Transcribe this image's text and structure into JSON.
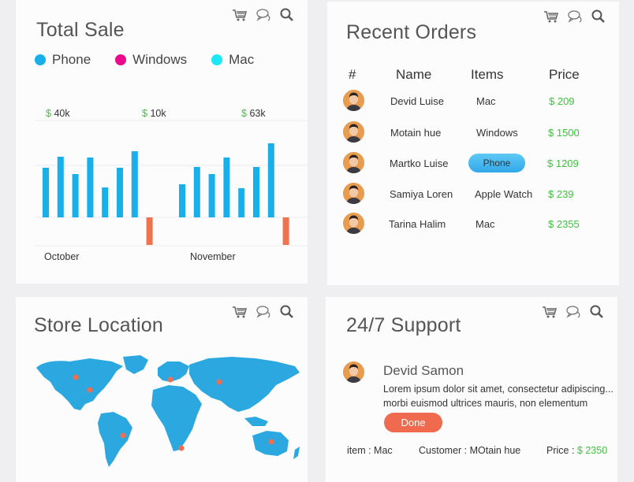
{
  "colors": {
    "phone": "#17b0ea",
    "windows": "#ec0a8c",
    "mac": "#1be8f5",
    "negative": "#f0734f",
    "price": "#3ec43e",
    "map": "#2ba8df",
    "marker": "#ee6f50"
  },
  "icons": [
    "cart-icon",
    "chat-icon",
    "search-icon"
  ],
  "total_sale": {
    "title": "Total Sale",
    "legend": [
      "Phone",
      "Windows",
      "Mac"
    ]
  },
  "chart_data": {
    "type": "bar",
    "series": [
      {
        "name": "Phone",
        "groups": [
          {
            "label": "October",
            "values": [
              0.63,
              0.77,
              0.55,
              0.76,
              0.38,
              0.63,
              0.84,
              -0.35
            ]
          },
          {
            "label": "November",
            "values": [
              0.42,
              0.64,
              0.55,
              0.76,
              0.37,
              0.64,
              0.94,
              -0.35
            ]
          }
        ]
      }
    ],
    "annotations": [
      {
        "currency": "$",
        "value": "40k"
      },
      {
        "currency": "$",
        "value": "10k"
      },
      {
        "currency": "$",
        "value": "63k"
      }
    ],
    "xlabels": [
      "October",
      "November"
    ],
    "grid": true
  },
  "recent_orders": {
    "title": "Recent Orders",
    "headers": [
      "#",
      "Name",
      "Items",
      "Price"
    ],
    "rows": [
      {
        "name": "Devid Luise",
        "item": "Mac",
        "price": "$ 209"
      },
      {
        "name": "Motain hue",
        "item": "Windows",
        "price": "$ 1500"
      },
      {
        "name": "Martko Luise",
        "item": "Phone",
        "price": "$ 1209"
      },
      {
        "name": "Samiya Loren",
        "item": "Apple Watch",
        "price": "$ 239"
      },
      {
        "name": "Tarina Halim",
        "item": "Mac",
        "price": "$ 2355"
      }
    ]
  },
  "store_location": {
    "title": "Store Location"
  },
  "support": {
    "title": "24/7 Support",
    "name": "Devid Samon",
    "line1": "Lorem ipsum dolor sit amet, consectetur adipiscing...",
    "line2": "morbi euismod ultrices mauris, non elementum",
    "button": "Done",
    "item": "item : Mac",
    "customer": "Customer : MOtain hue",
    "price_label": "Price :",
    "price_value": "$ 2350"
  }
}
